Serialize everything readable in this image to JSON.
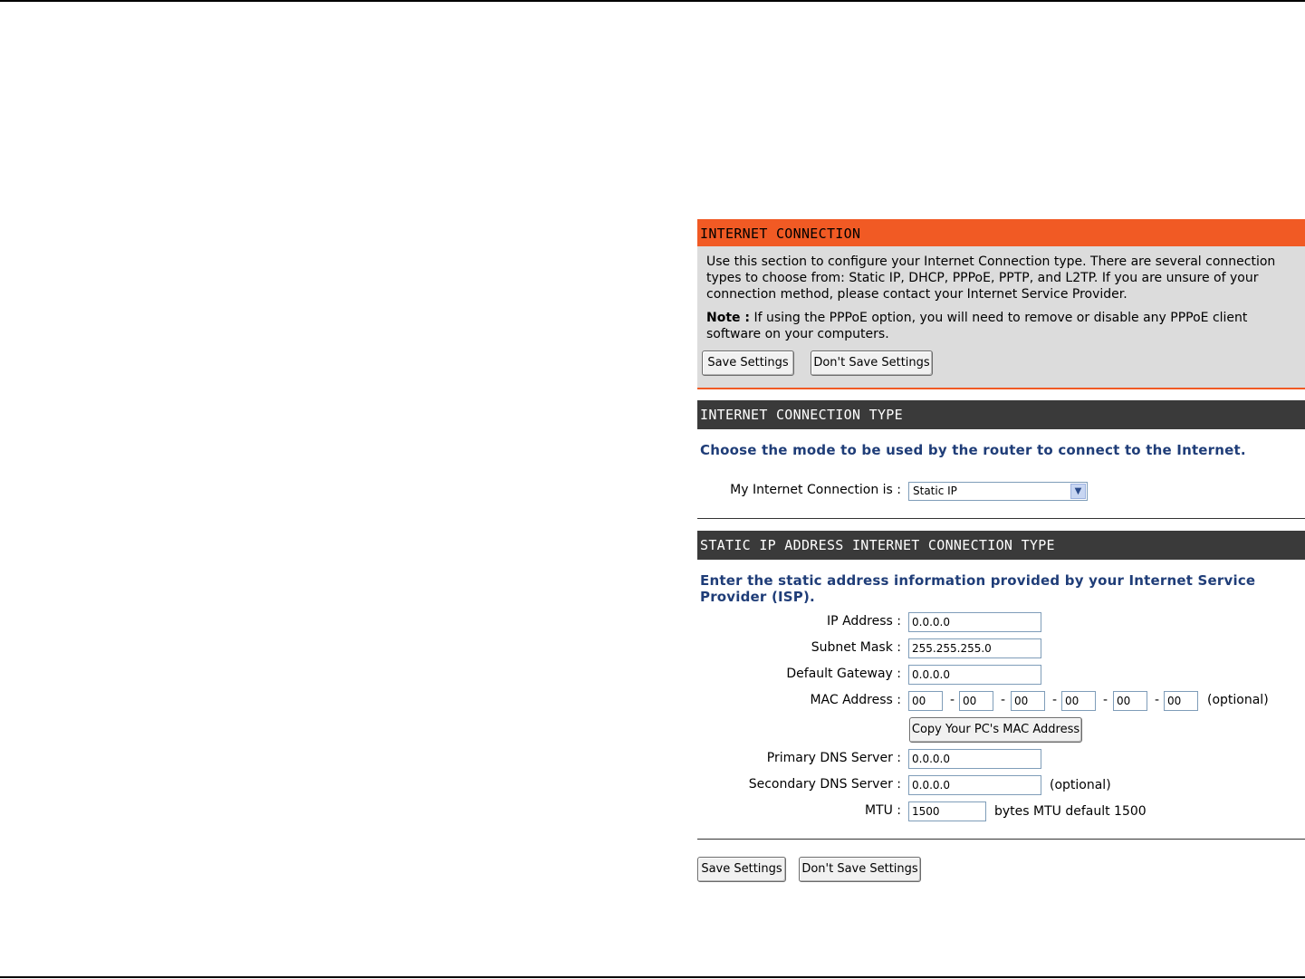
{
  "internet_connection": {
    "title": "INTERNET CONNECTION",
    "description": "Use this section to configure your Internet Connection type. There are several connection types to choose from: Static IP, DHCP, PPPoE, PPTP, and L2TP. If you are unsure of your connection method, please contact your Internet Service Provider.",
    "note_label": "Note :",
    "note_text": " If using the PPPoE option, you will need to remove or disable any PPPoE client software on your computers.",
    "save_label": "Save Settings",
    "dont_save_label": "Don't Save Settings"
  },
  "connection_type": {
    "title": "INTERNET CONNECTION TYPE",
    "instruction": "Choose the mode to be used by the router to connect to the Internet.",
    "label": "My Internet Connection is  :",
    "selected": "Static IP"
  },
  "static_ip": {
    "title": "STATIC IP ADDRESS INTERNET CONNECTION TYPE",
    "instruction": "Enter the static address information provided by your Internet Service Provider (ISP).",
    "ip_label": "IP Address  :",
    "ip_value": "0.0.0.0",
    "subnet_label": "Subnet Mask  :",
    "subnet_value": "255.255.255.0",
    "gateway_label": "Default Gateway  :",
    "gateway_value": "0.0.0.0",
    "mac_label": "MAC Address :",
    "mac_values": [
      "00",
      "00",
      "00",
      "00",
      "00",
      "00"
    ],
    "mac_sep": "-",
    "optional": "(optional)",
    "copy_mac_label": "Copy Your PC's MAC Address",
    "primary_dns_label": "Primary DNS Server :",
    "primary_dns_value": "0.0.0.0",
    "secondary_dns_label": "Secondary DNS Server :",
    "secondary_dns_value": "0.0.0.0",
    "mtu_label": "MTU :",
    "mtu_value": "1500",
    "mtu_note": "bytes MTU default 1500"
  },
  "footer": {
    "save_label": "Save Settings",
    "dont_save_label": "Don't Save Settings"
  }
}
